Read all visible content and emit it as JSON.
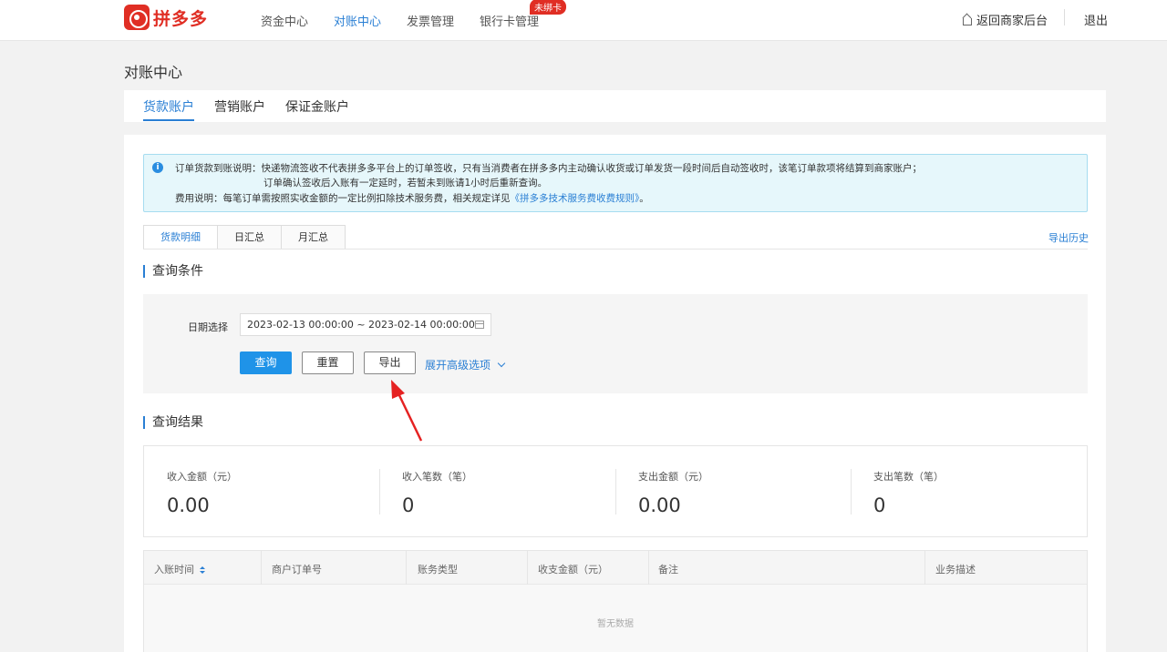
{
  "brand": {
    "name": "拼多多",
    "color": "#e02e24"
  },
  "nav": {
    "items": [
      {
        "label": "资金中心",
        "active": false
      },
      {
        "label": "对账中心",
        "active": true
      },
      {
        "label": "发票管理",
        "active": false
      },
      {
        "label": "银行卡管理",
        "active": false,
        "badge": "未绑卡"
      }
    ],
    "back_label": "返回商家后台",
    "back_icon": "home-icon",
    "logout_label": "退出"
  },
  "page": {
    "title": "对账中心",
    "accent_color": "#2a7fd4",
    "account_tabs": [
      {
        "label": "货款账户",
        "active": true
      },
      {
        "label": "营销账户",
        "active": false
      },
      {
        "label": "保证金账户",
        "active": false
      }
    ]
  },
  "notice": {
    "icon": "info-icon",
    "line1": "订单货款到账说明：快递物流签收不代表拼多多平台上的订单签收，只有当消费者在拼多多内主动确认收货或订单发货一段时间后自动签收时，该笔订单款项将结算到商家账户；",
    "line2": "订单确认签收后入账有一定延时，若暂未到账请1小时后重新查询。",
    "line3_prefix": "费用说明：每笔订单需按照实收金额的一定比例扣除技术服务费，相关规定详见",
    "line3_link": "《拼多多技术服务费收费规则》",
    "line3_suffix": "。"
  },
  "sub_tabs": [
    {
      "label": "货款明细",
      "active": true
    },
    {
      "label": "日汇总",
      "active": false
    },
    {
      "label": "月汇总",
      "active": false
    }
  ],
  "export_history": "导出历史",
  "query": {
    "section_title": "查询条件",
    "date_label": "日期选择",
    "date_value": "2023-02-13 00:00:00 ~ 2023-02-14 00:00:00",
    "calendar_icon": "calendar-icon",
    "search_label": "查询",
    "reset_label": "重置",
    "export_label": "导出",
    "advanced_label": "展开高级选项"
  },
  "results": {
    "section_title": "查询结果",
    "stats": [
      {
        "label": "收入金额（元）",
        "value": "0.00"
      },
      {
        "label": "收入笔数（笔）",
        "value": "0"
      },
      {
        "label": "支出金额（元）",
        "value": "0.00"
      },
      {
        "label": "支出笔数（笔）",
        "value": "0"
      }
    ]
  },
  "table": {
    "columns": [
      "入账时间",
      "商户订单号",
      "账务类型",
      "收支金额（元）",
      "备注",
      "业务描述"
    ],
    "empty_text": "暂无数据"
  },
  "annotation": {
    "color": "#e52222"
  }
}
